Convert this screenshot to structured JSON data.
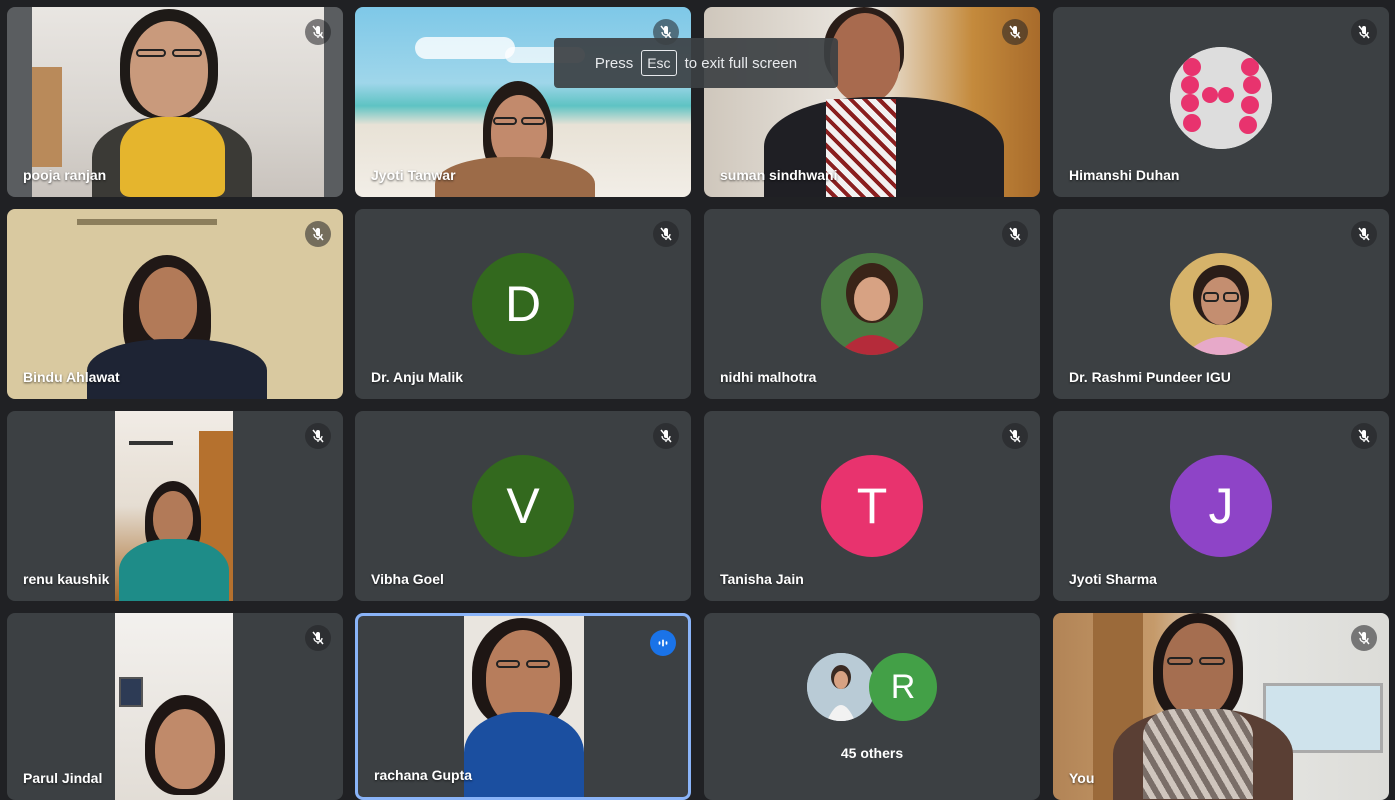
{
  "toast": {
    "prefix": "Press",
    "key": "Esc",
    "suffix": "to exit full screen"
  },
  "participants": [
    {
      "name": "pooja ranjan",
      "muted": true
    },
    {
      "name": "Jyoti Tanwar",
      "muted": true
    },
    {
      "name": "suman sindhwani",
      "muted": true
    },
    {
      "name": "Himanshi Duhan",
      "muted": true
    },
    {
      "name": "Bindu Ahlawat",
      "muted": true
    },
    {
      "name": "Dr. Anju Malik",
      "muted": true,
      "initial": "D",
      "color": "#33691e"
    },
    {
      "name": "nidhi malhotra",
      "muted": true
    },
    {
      "name": "Dr. Rashmi Pundeer IGU",
      "muted": true
    },
    {
      "name": "renu kaushik",
      "muted": true
    },
    {
      "name": "Vibha Goel",
      "muted": true,
      "initial": "V",
      "color": "#33691e"
    },
    {
      "name": "Tanisha Jain",
      "muted": true,
      "initial": "T",
      "color": "#e8336e"
    },
    {
      "name": "Jyoti Sharma",
      "muted": true,
      "initial": "J",
      "color": "#8e44c7"
    },
    {
      "name": "Parul Jindal",
      "muted": true
    },
    {
      "name": "rachana Gupta",
      "muted": false,
      "speaking": true
    },
    {
      "others_label": "45 others",
      "others_initial": "R",
      "others_color": "#43a047"
    },
    {
      "name": "You",
      "muted": true
    }
  ],
  "colors": {
    "background": "#202124",
    "tile": "#3c4043",
    "speaking_border": "#8ab4f8"
  }
}
